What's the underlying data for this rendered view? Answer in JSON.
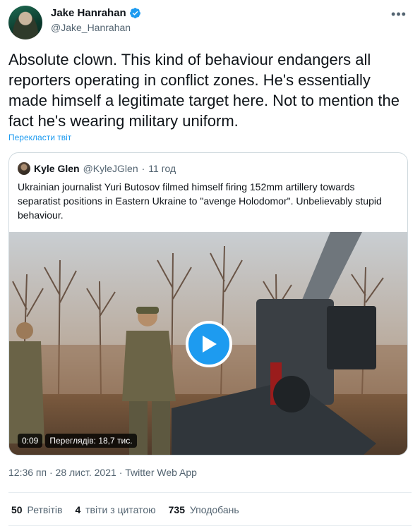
{
  "author": {
    "display_name": "Jake Hanrahan",
    "handle": "@Jake_Hanrahan",
    "avatar_icon": "user-avatar",
    "verified": true
  },
  "more_icon": "ellipsis-icon",
  "tweet": {
    "text": "Absolute clown. This kind of behaviour endangers all reporters operating in conflict zones. He's essentially made himself a legitimate target here. Not to mention the fact he's wearing military uniform.",
    "translate_label": "Перекласти твіт"
  },
  "quoted_tweet": {
    "display_name": "Kyle Glen",
    "handle": "@KyleJGlen",
    "separator": "·",
    "time": "11 год",
    "text": "Ukrainian journalist Yuri Butosov filmed himself firing 152mm artillery towards separatist positions in Eastern Ukraine to \"avenge Holodomor\". Unbelievably stupid behaviour.",
    "video": {
      "duration": "0:09",
      "views_label": "Переглядів: 18,7 тис.",
      "play_icon": "play-icon"
    }
  },
  "meta": {
    "time": "12:36 пп",
    "date": "28 лист. 2021",
    "source": "Twitter Web App",
    "separator": "·"
  },
  "stats": {
    "retweets_count": "50",
    "retweets_label": "Ретвітів",
    "quotes_count": "4",
    "quotes_label": "твіти з цитатою",
    "likes_count": "735",
    "likes_label": "Уподобань"
  },
  "colors": {
    "accent": "#1d9bf0",
    "text_primary": "#0f1419",
    "text_secondary": "#536471",
    "border": "#cfd9de"
  }
}
